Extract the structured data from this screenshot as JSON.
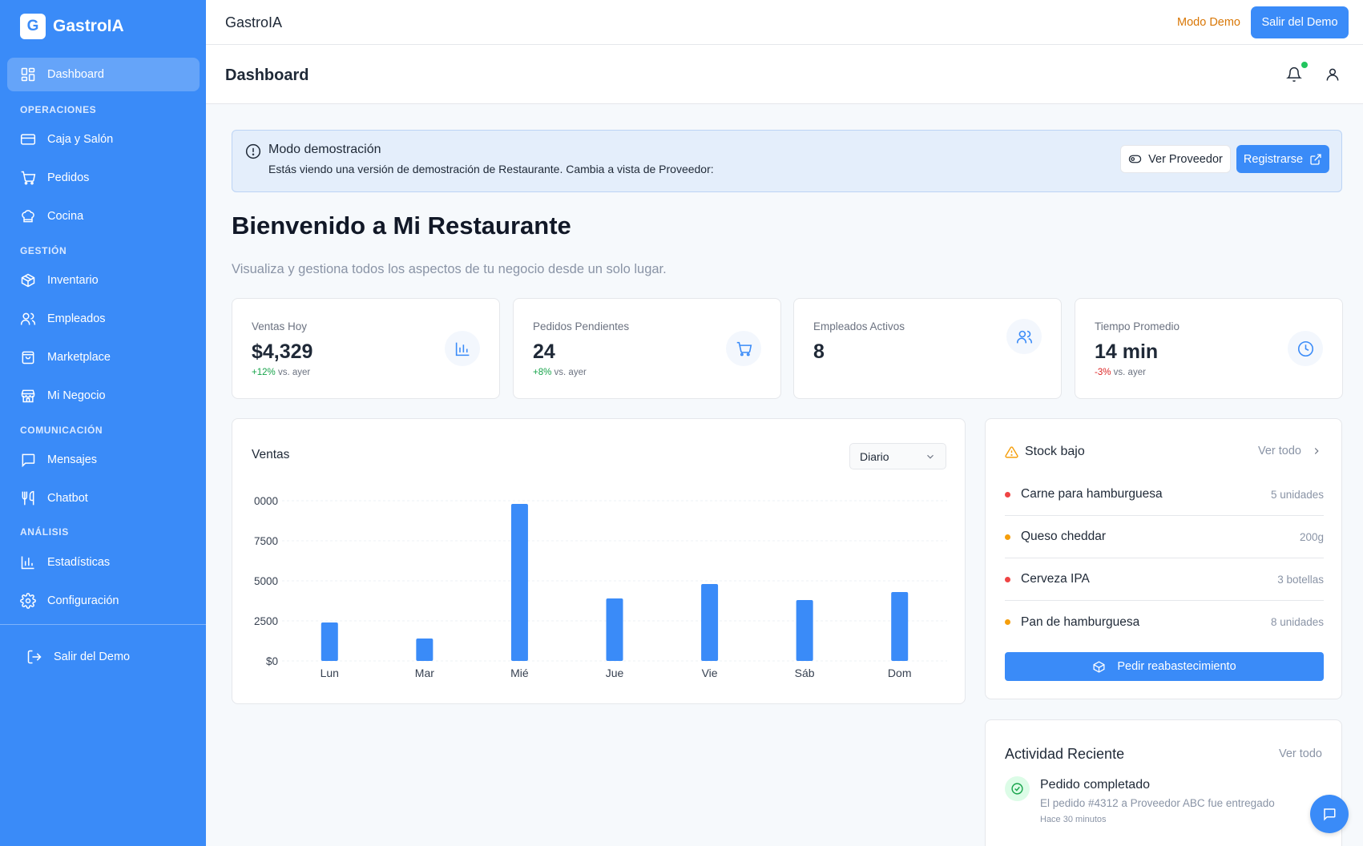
{
  "app": {
    "logo_letter": "G",
    "name": "GastroIA"
  },
  "sidebar": {
    "dashboard": "Dashboard",
    "sections": {
      "operaciones": "OPERACIONES",
      "gestion": "GESTIÓN",
      "comunicacion": "COMUNICACIÓN",
      "analisis": "ANÁLISIS"
    },
    "items": {
      "caja": "Caja y Salón",
      "pedidos": "Pedidos",
      "cocina": "Cocina",
      "inventario": "Inventario",
      "empleados": "Empleados",
      "marketplace": "Marketplace",
      "negocio": "Mi Negocio",
      "mensajes": "Mensajes",
      "chatbot": "Chatbot",
      "estadisticas": "Estadísticas",
      "configuracion": "Configuración"
    },
    "exit": "Salir del Demo"
  },
  "topbar": {
    "title": "GastroIA",
    "mode": "Modo Demo",
    "exit_button": "Salir del Demo"
  },
  "header": {
    "title": "Dashboard"
  },
  "banner": {
    "title": "Modo demostración",
    "text": "Estás viendo una versión de demostración de Restaurante.  Cambia a vista de Proveedor:",
    "view_supplier": "Ver Proveedor",
    "register": "Registrarse"
  },
  "welcome": {
    "title": "Bienvenido a Mi Restaurante",
    "subtitle": "Visualiza y gestiona todos los aspectos de tu negocio desde un solo lugar."
  },
  "stats": [
    {
      "label": "Ventas Hoy",
      "value": "$4,329",
      "trend": "+12%",
      "trend_suffix": "vs. ayer",
      "icon": "bar-chart-icon"
    },
    {
      "label": "Pedidos Pendientes",
      "value": "24",
      "trend": "+8%",
      "trend_suffix": "vs. ayer",
      "icon": "cart-icon"
    },
    {
      "label": "Empleados Activos",
      "value": "8",
      "icon": "users-icon"
    },
    {
      "label": "Tiempo Promedio",
      "value": "14 min",
      "trend": "-3%",
      "trend_suffix": "vs. ayer",
      "icon": "clock-icon"
    }
  ],
  "sales": {
    "title": "Ventas",
    "period": "Diario"
  },
  "chart_data": {
    "type": "bar",
    "categories": [
      "Lun",
      "Mar",
      "Mié",
      "Jue",
      "Vie",
      "Sáb",
      "Dom"
    ],
    "values": [
      2400,
      1400,
      9800,
      3900,
      4800,
      3800,
      4300
    ],
    "ytick_labels": [
      "$0",
      "2500",
      "5000",
      "7500",
      "0000"
    ],
    "ytick_values": [
      0,
      2500,
      5000,
      7500,
      10000
    ],
    "ylim": [
      0,
      10000
    ],
    "bar_color": "#3a8bf8",
    "grid": true
  },
  "stock": {
    "title": "Stock bajo",
    "see_all": "Ver todo",
    "items": [
      {
        "name": "Carne para hamburguesa",
        "qty": "5 unidades",
        "status": "#ef4444"
      },
      {
        "name": "Queso cheddar",
        "qty": "200g",
        "status": "#f59e0b"
      },
      {
        "name": "Cerveza IPA",
        "qty": "3 botellas",
        "status": "#ef4444"
      },
      {
        "name": "Pan de hamburguesa",
        "qty": "8 unidades",
        "status": "#f59e0b"
      }
    ],
    "restock_button": "Pedir reabastecimiento"
  },
  "activity": {
    "title": "Actividad Reciente",
    "see_all": "Ver todo",
    "items": [
      {
        "title": "Pedido completado",
        "desc": "El pedido #4312 a Proveedor ABC fue entregado",
        "time": "Hace 30 minutos"
      }
    ]
  },
  "colors": {
    "accent": "#3a8bf8",
    "warning": "#d97706",
    "success": "#16a34a",
    "danger": "#dc2626"
  }
}
